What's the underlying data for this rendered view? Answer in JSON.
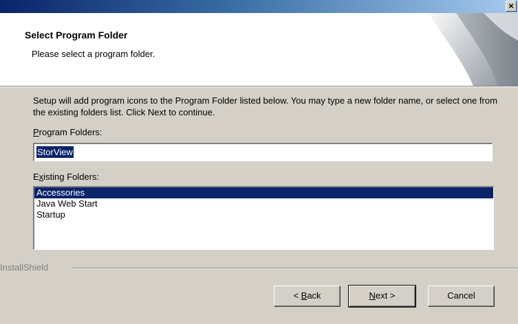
{
  "titlebar": {
    "close_label": "×"
  },
  "header": {
    "title": "Select Program Folder",
    "subtitle": "Please select a program folder."
  },
  "description": "Setup will add program icons to the Program Folder listed below.  You may type a new folder name, or select one from the existing folders list.  Click Next to continue.",
  "program_folders": {
    "label_accel": "P",
    "label_rest": "rogram Folders:",
    "value": "StorView"
  },
  "existing_folders": {
    "label_pre": "E",
    "label_accel": "x",
    "label_rest": "isting Folders:",
    "items": [
      "Accessories",
      "Java Web Start",
      "Startup"
    ],
    "selected": "Accessories"
  },
  "brand": "InstallShield",
  "buttons": {
    "back_pre": "< ",
    "back_accel": "B",
    "back_rest": "ack",
    "next_accel": "N",
    "next_rest": "ext >",
    "cancel": "Cancel"
  }
}
